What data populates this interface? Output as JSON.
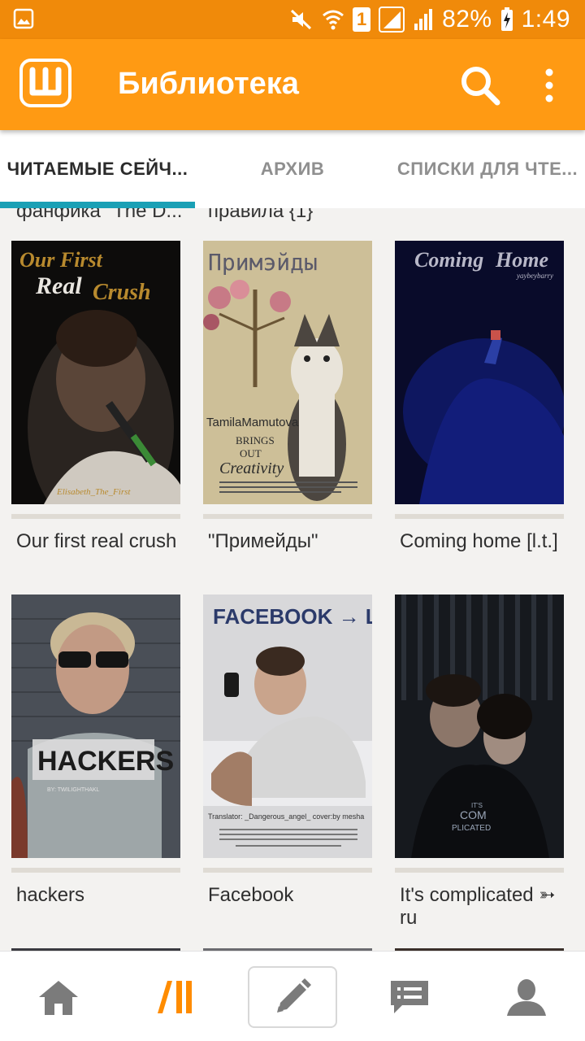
{
  "status_bar": {
    "battery": "82%",
    "time": "1:49",
    "sim_slot": "1"
  },
  "app_bar": {
    "title": "Библиотека",
    "logo_letter": "Ш",
    "icons": [
      "search-icon",
      "more-vert-icon"
    ]
  },
  "tabs": [
    {
      "label": "ЧИТАЕМЫЕ СЕЙЧ...",
      "active": true
    },
    {
      "label": "АРХИВ",
      "active": false
    },
    {
      "label": "СПИСКИ ДЛЯ ЧТЕ...",
      "active": false
    }
  ],
  "partial_titles": [
    "фанфика \"The D...",
    "правила {1}"
  ],
  "stories": [
    {
      "title": "Our first real crush",
      "cover": {
        "heading": "Our First Real Crush",
        "author": "Elisabeth_The_First"
      }
    },
    {
      "title": "\"Примейды\"",
      "cover": {
        "heading": "Примэйды",
        "author": "TamilaMamutova",
        "tagline": "BRINGS OUT",
        "tagline2": "Creativity"
      }
    },
    {
      "title": "Coming home [l.t.]",
      "cover": {
        "heading": "Coming Home",
        "author": "yaybeybarry"
      }
    },
    {
      "title": "hackers",
      "cover": {
        "heading": "HACKERS",
        "author": "BY: TWILIGHTHAKL"
      }
    },
    {
      "title": "Facebook",
      "cover": {
        "heading": "FACEBOOK → LP",
        "credit": "Translator: _Dangerous_angel_     cover:by mesha"
      }
    },
    {
      "title": "It's complicated ➳ ru",
      "cover": {
        "heading": "IT'S COM PLICATED"
      }
    }
  ],
  "bottom_nav": [
    {
      "name": "home",
      "icon": "home-icon"
    },
    {
      "name": "library",
      "icon": "library-icon",
      "active": true
    },
    {
      "name": "write",
      "icon": "pencil-icon"
    },
    {
      "name": "messages",
      "icon": "chat-icon"
    },
    {
      "name": "profile",
      "icon": "profile-icon"
    }
  ],
  "colors": {
    "status_bar": "#f08a0a",
    "app_bar": "#ff9a13",
    "tab_indicator": "#1aa0b5",
    "active_nav": "#ff8c00"
  }
}
